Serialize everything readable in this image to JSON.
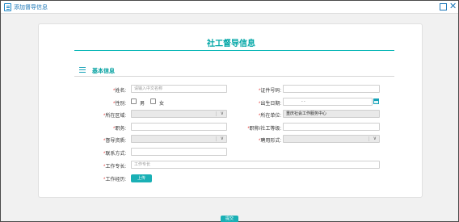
{
  "window": {
    "title": "添加督导信息"
  },
  "form": {
    "title": "社工督导信息",
    "section_title": "基本信息",
    "required_mark": "*",
    "fields": {
      "name": {
        "label": "姓名:",
        "placeholder": "请输入中文名称"
      },
      "id_number": {
        "label": "证件号码:",
        "value": ""
      },
      "gender": {
        "label": "性别:",
        "options": [
          "男",
          "女"
        ]
      },
      "birth_date": {
        "label": "出生日期:",
        "value": "    -    -    "
      },
      "region": {
        "label": "所在区域:",
        "value": ""
      },
      "organization": {
        "label": "所在单位:",
        "value": "重庆社会工作服务中心"
      },
      "position": {
        "label": "职务:",
        "value": ""
      },
      "title_level": {
        "label": "职称/社工等级:",
        "value": ""
      },
      "supervisor_qualification": {
        "label": "督导资质:",
        "value": ""
      },
      "employment_type": {
        "label": "聘用形式:",
        "value": ""
      },
      "contact": {
        "label": "联系方式:",
        "value": ""
      },
      "specialty": {
        "label": "工作专长:",
        "placeholder": "工作专长"
      },
      "experience": {
        "label": "工作经历:",
        "button_label": "上传"
      }
    },
    "submit_label": "提交"
  }
}
